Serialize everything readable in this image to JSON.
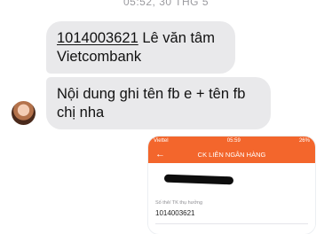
{
  "header": {
    "timestamp": "05:52, 30 THG 5"
  },
  "messages": [
    {
      "account": "1014003621",
      "rest": " Lê văn tâm Vietcombank"
    },
    {
      "text": "Nội dung ghi tên fb e + tên fb chị nha"
    }
  ],
  "screenshot": {
    "carrier": "Viettel",
    "time": "05:59",
    "battery": "26%",
    "title": "CK LIÊN NGÂN HÀNG",
    "back_icon": "arrow-left-icon",
    "field_label": "Số thẻ/ TK thụ hưởng",
    "field_value": "1014003621"
  },
  "colors": {
    "bubble": "#e9e9eb",
    "accent": "#f3662c"
  }
}
